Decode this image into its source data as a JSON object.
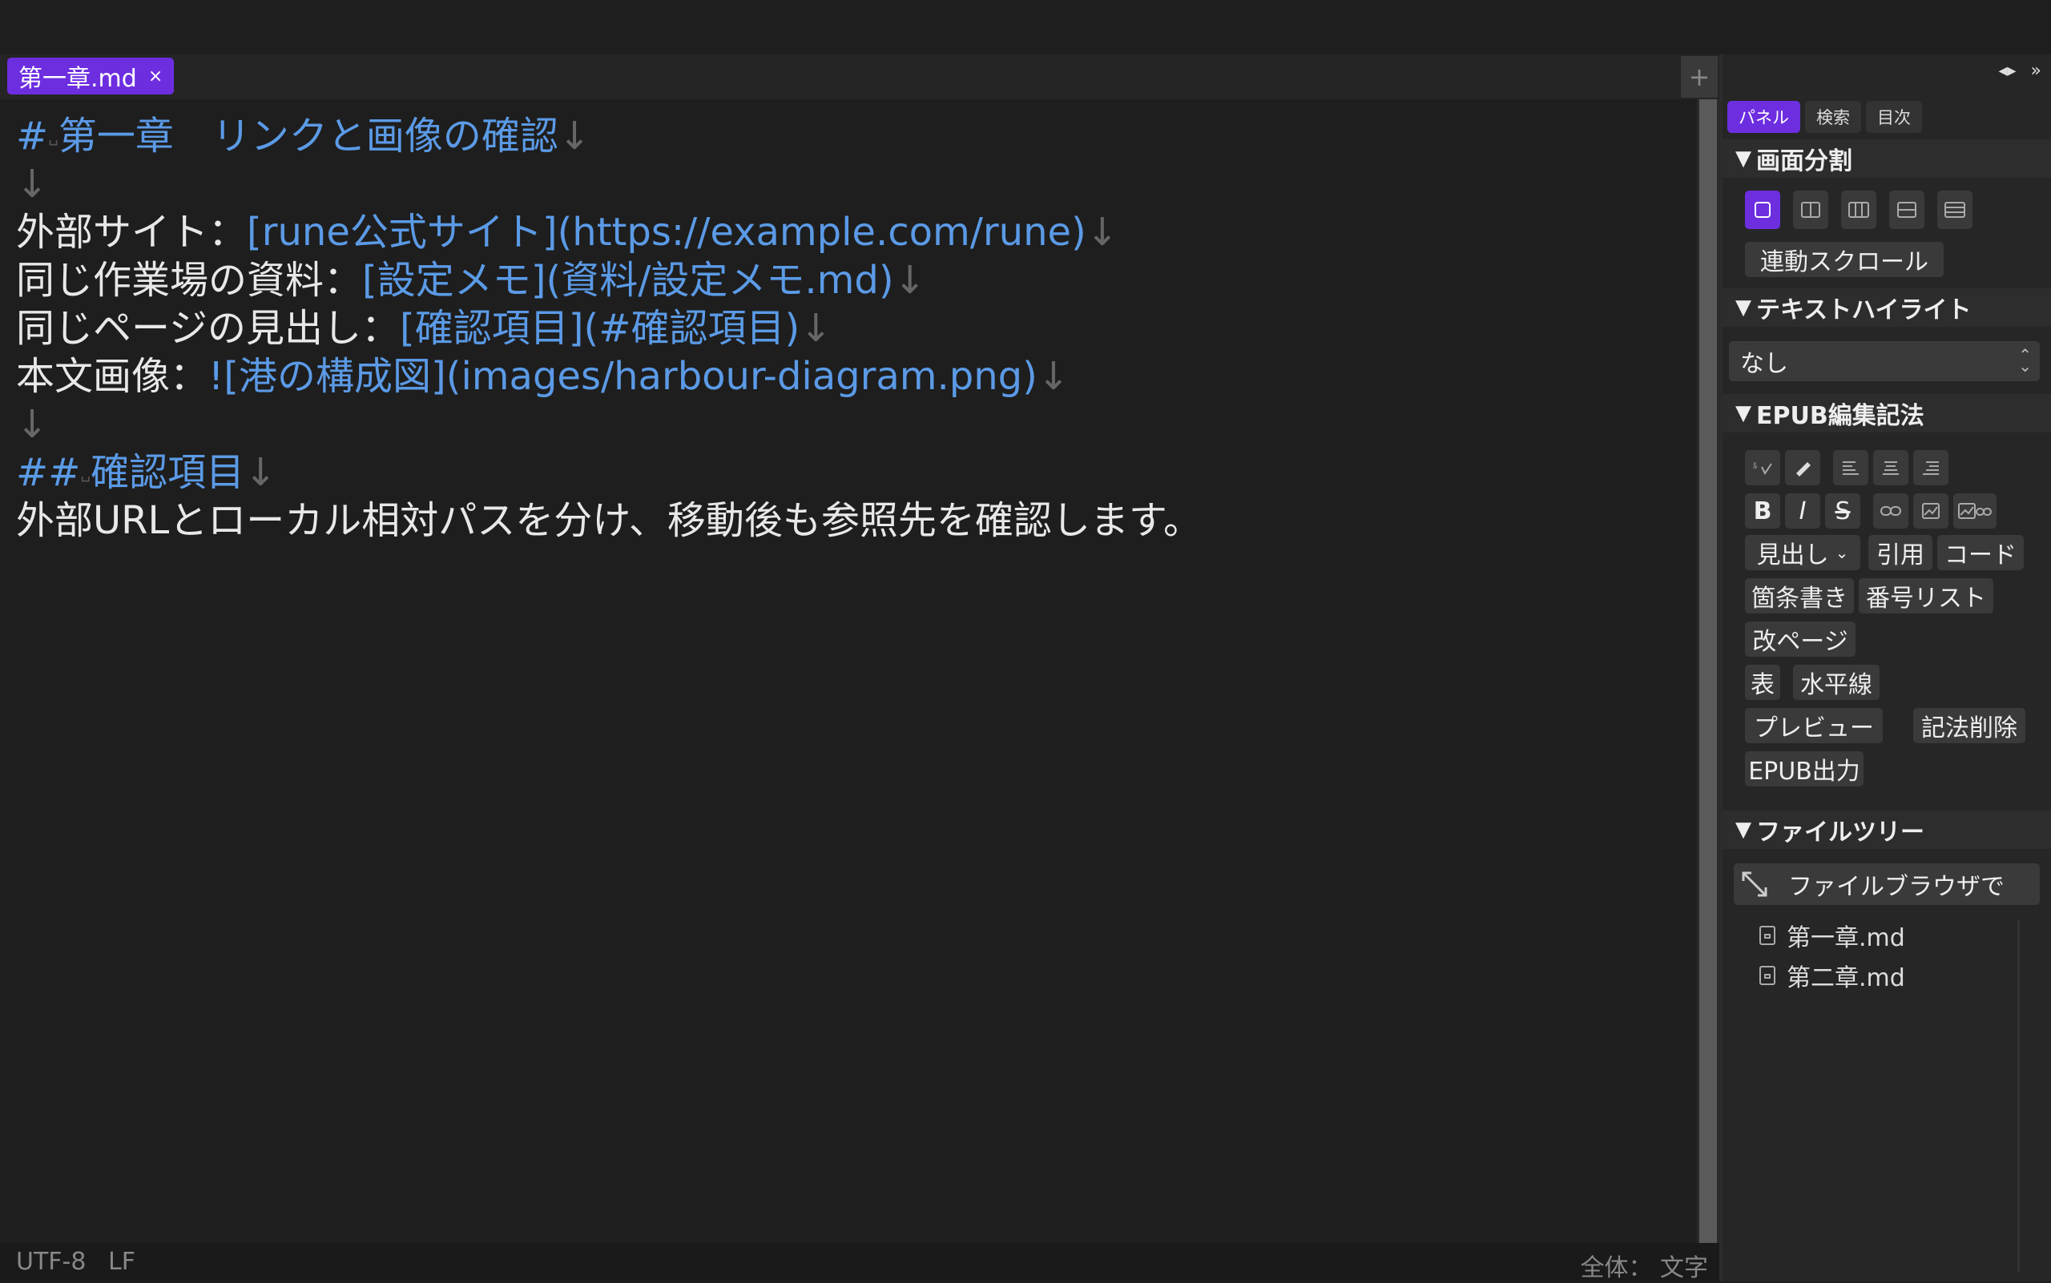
{
  "tab": {
    "label": "第一章.md",
    "close": "×"
  },
  "tabbar": {
    "plus": "+"
  },
  "editor": {
    "lines": [
      {
        "mark": "#",
        "space": "␣",
        "text": "第一章　リンクと画像の確認",
        "ret": "↓"
      },
      {
        "ret": "↓"
      },
      {
        "prefix": "外部サイト：",
        "link": "[rune公式サイト](https://example.com/rune)",
        "ret": "↓"
      },
      {
        "prefix": "同じ作業場の資料：",
        "link": "[設定メモ](資料/設定メモ.md)",
        "ret": "↓"
      },
      {
        "prefix": "同じページの見出し：",
        "link": "[確認項目](#確認項目)",
        "ret": "↓"
      },
      {
        "prefix": "本文画像：",
        "link": "![港の構成図](images/harbour-diagram.png)",
        "ret": "↓"
      },
      {
        "ret": "↓"
      },
      {
        "mark": "##",
        "space": "␣",
        "text": "確認項目",
        "ret": "↓"
      },
      {
        "prefix": "外部URLとローカル相対パスを分け、移動後も参照先を確認します。"
      }
    ]
  },
  "status": {
    "encoding": "UTF-8",
    "eol": "LF",
    "count": "全体： 文字"
  },
  "panel": {
    "top_icons": [
      "◂▸",
      "»"
    ],
    "tabs": [
      "パネル",
      "検索",
      "目次"
    ],
    "sections": {
      "split": "画面分割",
      "highlight": "テキストハイライト",
      "epub": "EPUB編集記法",
      "tree": "ファイルツリー"
    },
    "sync_scroll": "連動スクロール",
    "highlight_value": "なし",
    "epub_buttons": {
      "heading": "見出し",
      "quote": "引用",
      "code": "コード",
      "bullets": "箇条書き",
      "numbered": "番号リスト",
      "pagebreak": "改ページ",
      "table": "表",
      "hr": "水平線",
      "preview": "プレビュー",
      "clear": "記法削除",
      "export": "EPUB出力"
    },
    "format_glyphs": {
      "bold": "B",
      "italic": "I",
      "strike": "S"
    },
    "open_browser": "ファイルブラウザで",
    "files": [
      "第一章.md",
      "第二章.md"
    ]
  },
  "colors": {
    "accent": "#6d2ee0",
    "link": "#5b9ae6"
  }
}
